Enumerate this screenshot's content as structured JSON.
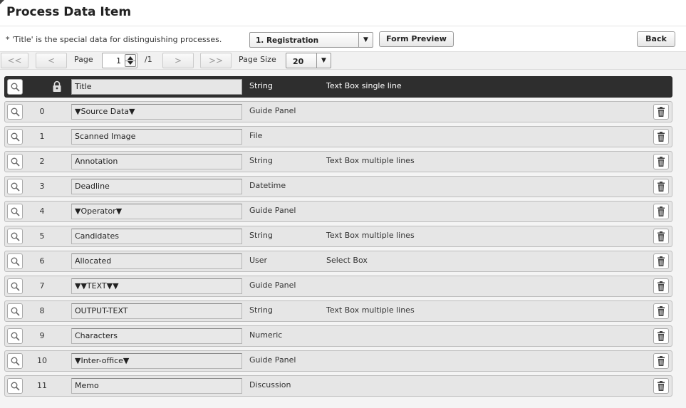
{
  "page": {
    "title": "Process Data Item",
    "note": "* 'Title' is the special data for distinguishing processes."
  },
  "toolbar": {
    "form_select_value": "1. Registration",
    "form_preview_label": "Form Preview",
    "back_label": "Back"
  },
  "pager": {
    "first_label": "<<",
    "prev_label": "<",
    "page_label": "Page",
    "page_value": "1",
    "page_total": "/1",
    "next_label": ">",
    "last_label": ">>",
    "page_size_label": "Page Size",
    "page_size_value": "20"
  },
  "header_row": {
    "name": "Title",
    "type": "String",
    "control": "Text Box single line"
  },
  "rows": [
    {
      "index": "0",
      "name": "▼Source Data▼",
      "type": "Guide Panel",
      "control": ""
    },
    {
      "index": "1",
      "name": "Scanned Image",
      "type": "File",
      "control": ""
    },
    {
      "index": "2",
      "name": "Annotation",
      "type": "String",
      "control": "Text Box multiple lines"
    },
    {
      "index": "3",
      "name": "Deadline",
      "type": "Datetime",
      "control": ""
    },
    {
      "index": "4",
      "name": "▼Operator▼",
      "type": "Guide Panel",
      "control": ""
    },
    {
      "index": "5",
      "name": "Candidates",
      "type": "String",
      "control": "Text Box multiple lines"
    },
    {
      "index": "6",
      "name": "Allocated",
      "type": "User",
      "control": "Select Box"
    },
    {
      "index": "7",
      "name": "▼▼TEXT▼▼",
      "type": "Guide Panel",
      "control": ""
    },
    {
      "index": "8",
      "name": "OUTPUT-TEXT",
      "type": "String",
      "control": "Text Box multiple lines"
    },
    {
      "index": "9",
      "name": "Characters",
      "type": "Numeric",
      "control": ""
    },
    {
      "index": "10",
      "name": "▼Inter-office▼",
      "type": "Guide Panel",
      "control": ""
    },
    {
      "index": "11",
      "name": "Memo",
      "type": "Discussion",
      "control": ""
    }
  ],
  "icons": {
    "row_view": "magnifier-icon",
    "title_lock": "lock-icon",
    "row_delete": "trash-icon",
    "dropdown": "chevron-down-icon"
  },
  "colors": {
    "header_row_bg": "#2e2e2e",
    "row_bg": "#e6e6e6"
  }
}
